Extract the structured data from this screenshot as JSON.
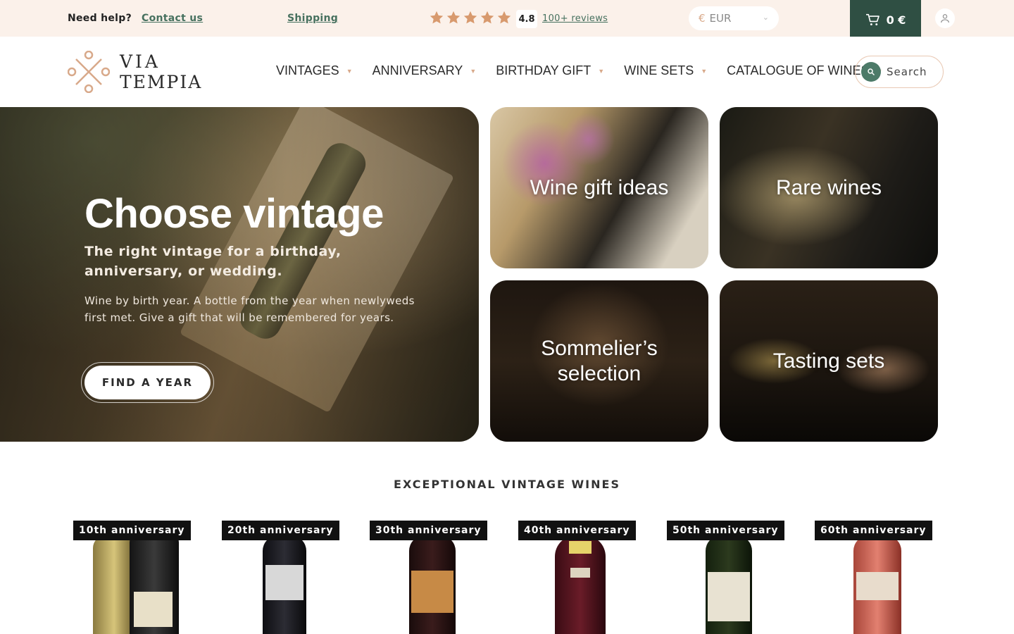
{
  "topbar": {
    "help_label": "Need help?",
    "contact_label": "Contact us",
    "shipping_label": "Shipping",
    "rating": "4.8",
    "rating_stars": 5,
    "reviews_label": "100+ reviews",
    "currency_symbol": "€",
    "currency_value": "EUR",
    "cart_total": "0 €"
  },
  "header": {
    "logo_line1": "VIA",
    "logo_line2": "TEMPIA",
    "nav": [
      {
        "label": "VINTAGES"
      },
      {
        "label": "ANNIVERSARY"
      },
      {
        "label": "BIRTHDAY GIFT"
      },
      {
        "label": "WINE SETS"
      },
      {
        "label": "CATALOGUE OF WINES"
      }
    ],
    "search_placeholder": "Search"
  },
  "hero": {
    "title": "Choose vintage",
    "subtitle": "The right vintage for a birthday, anniversary, or wedding.",
    "text": "Wine by birth year. A bottle from the year when newlyweds first met. Give a gift that will be remembered for years.",
    "button_label": "FIND A YEAR"
  },
  "tiles": [
    {
      "label": "Wine gift ideas"
    },
    {
      "label": "Rare wines"
    },
    {
      "label": "Sommelier’s selection"
    },
    {
      "label": "Tasting sets"
    }
  ],
  "section": {
    "title": "EXCEPTIONAL VINTAGE WINES",
    "products": [
      {
        "badge": "10th anniversary"
      },
      {
        "badge": "20th anniversary"
      },
      {
        "badge": "30th anniversary"
      },
      {
        "badge": "40th anniversary"
      },
      {
        "badge": "50th anniversary"
      },
      {
        "badge": "60th anniversary"
      }
    ]
  },
  "colors": {
    "topbar_bg": "#fbf1ea",
    "accent_green": "#2f4f43",
    "link_green": "#47715f",
    "star": "#d89a6e",
    "caret": "#d8a98a"
  }
}
